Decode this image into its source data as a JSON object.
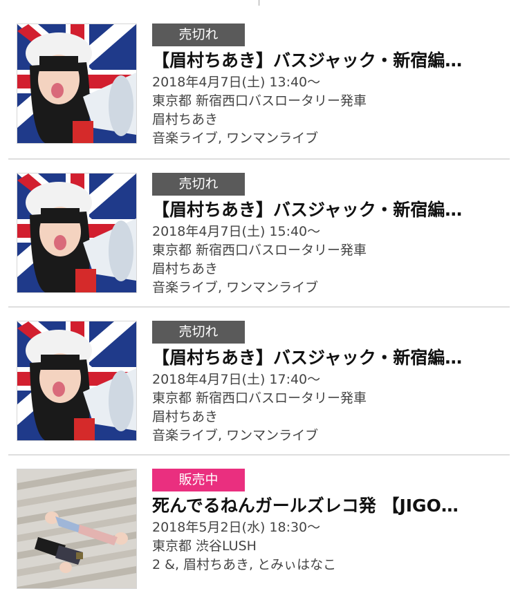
{
  "top_tabs": {
    "left_label": "",
    "right_label": ""
  },
  "events": [
    {
      "status": "売切れ",
      "status_color": "#5a5a5a",
      "title": "【眉村ちあき】バスジャック・新宿編…",
      "datetime": "2018年4月7日(土) 13:40〜",
      "venue": "東京都 新宿西口バスロータリー発車",
      "performers": "眉村ちあき",
      "genre": "音楽ライブ, ワンマンライブ",
      "thumb": "flag-megaphone-photo"
    },
    {
      "status": "売切れ",
      "status_color": "#5a5a5a",
      "title": "【眉村ちあき】バスジャック・新宿編…",
      "datetime": "2018年4月7日(土) 15:40〜",
      "venue": "東京都 新宿西口バスロータリー発車",
      "performers": "眉村ちあき",
      "genre": "音楽ライブ, ワンマンライブ",
      "thumb": "flag-megaphone-photo"
    },
    {
      "status": "売切れ",
      "status_color": "#5a5a5a",
      "title": "【眉村ちあき】バスジャック・新宿編…",
      "datetime": "2018年4月7日(土) 17:40〜",
      "venue": "東京都 新宿西口バスロータリー発車",
      "performers": "眉村ちあき",
      "genre": "音楽ライブ, ワンマンライブ",
      "thumb": "flag-megaphone-photo"
    },
    {
      "status": "販売中",
      "status_color": "#ea2f7f",
      "title": "死んでるねんガールズレコ発 【JIGO…",
      "datetime": "2018年5月2日(水) 18:30〜",
      "venue": "東京都 渋谷LUSH",
      "performers": "2 &, 眉村ちあき, とみぃはなこ",
      "genre": "",
      "thumb": "stairs-photo"
    }
  ]
}
